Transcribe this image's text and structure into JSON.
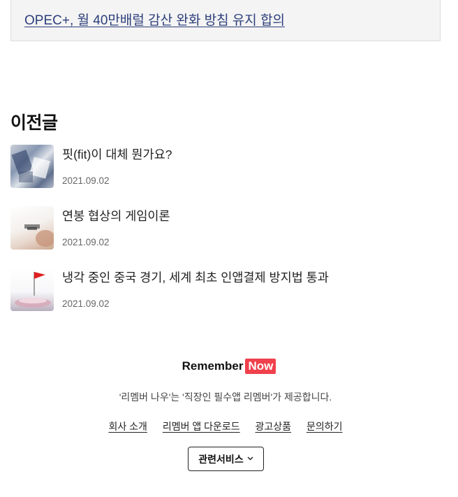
{
  "top_link": {
    "text": "OPEC+, 월 40만배럴 감산 완화 방침 유지 합의"
  },
  "previous": {
    "title": "이전글",
    "posts": [
      {
        "title": "핏(fit)이 대체 뭔가요?",
        "date": "2021.09.02"
      },
      {
        "title": "연봉 협상의 게임이론",
        "date": "2021.09.02"
      },
      {
        "title": "냉각 중인 중국 경기, 세계 최초 인앱결제 방지법 통과",
        "date": "2021.09.02"
      }
    ]
  },
  "footer": {
    "logo_text": "Remember",
    "logo_badge": "Now",
    "badge_color": "#f0414c",
    "description": "'리멤버 나우'는 '직장인 필수앱 리멤버'가 제공합니다.",
    "links": [
      "회사 소개",
      "리멤버 앱 다운로드",
      "광고상품",
      "문의하기"
    ],
    "related_button": "관련서비스",
    "related_icon": "chevron-down-icon"
  }
}
